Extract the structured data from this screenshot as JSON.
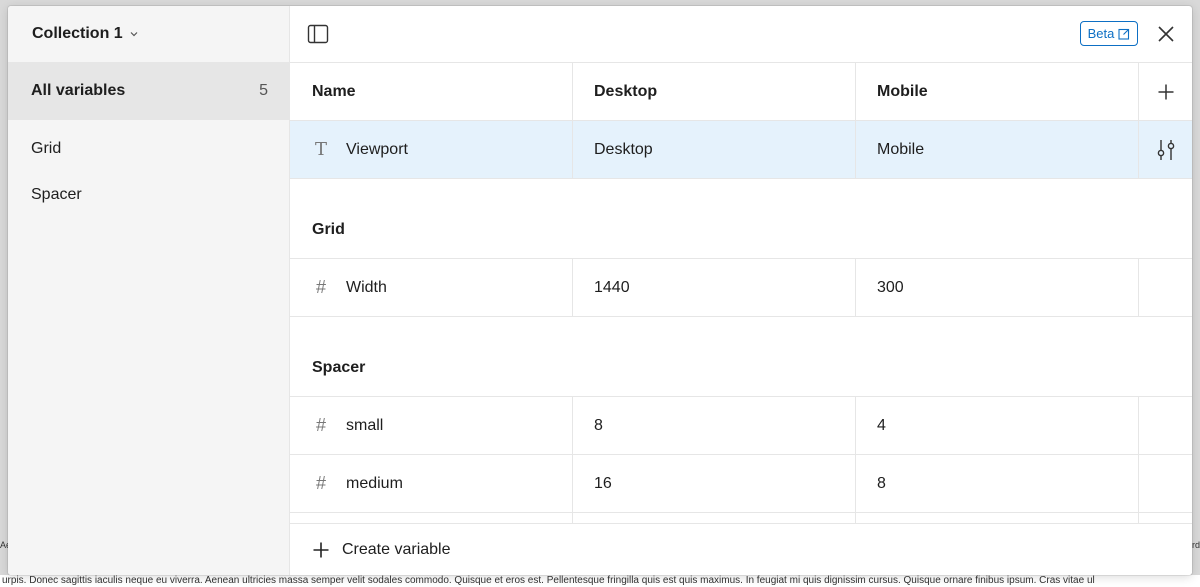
{
  "sidebar": {
    "collection_title": "Collection 1",
    "items": [
      {
        "label": "All variables",
        "count": "5"
      },
      {
        "label": "Grid"
      },
      {
        "label": "Spacer"
      }
    ]
  },
  "topbar": {
    "beta_label": "Beta"
  },
  "table": {
    "columns": [
      "Name",
      "Desktop",
      "Mobile"
    ],
    "selected_row": {
      "type": "T",
      "name": "Viewport",
      "desktop": "Desktop",
      "mobile": "Mobile"
    },
    "groups": [
      {
        "label": "Grid",
        "rows": [
          {
            "type": "#",
            "name": "Width",
            "desktop": "1440",
            "mobile": "300"
          }
        ]
      },
      {
        "label": "Spacer",
        "rows": [
          {
            "type": "#",
            "name": "small",
            "desktop": "8",
            "mobile": "4"
          },
          {
            "type": "#",
            "name": "medium",
            "desktop": "16",
            "mobile": "8"
          }
        ]
      }
    ]
  },
  "footer": {
    "create_label": "Create variable"
  },
  "background": {
    "text_strip": "urpis. Donec sagittis iaculis neque eu viverra. Aenean ultricies massa semper velit sodales commodo. Quisque et eros est. Pellentesque fringilla quis est quis maximus. In feugiat mi quis dignissim cursus. Quisque ornare finibus ipsum. Cras vitae ul",
    "left_edge": "Ae",
    "right_edge": "rd"
  },
  "colors": {
    "accent": "#0d6fc4",
    "selected_row": "#e5f2fc",
    "sidebar_bg": "#f5f5f5",
    "active_item_bg": "#e6e6e6"
  }
}
